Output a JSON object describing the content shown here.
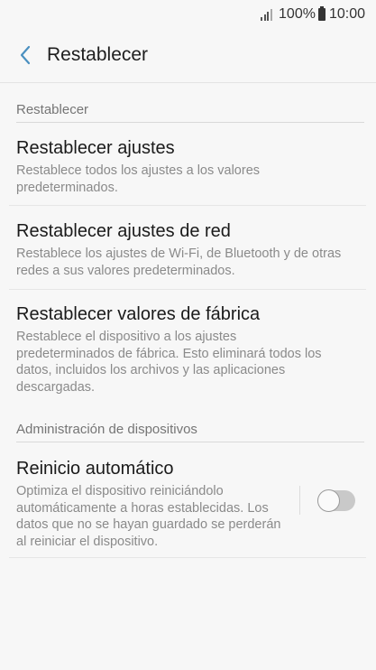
{
  "status_bar": {
    "battery": "100%",
    "time": "10:00"
  },
  "app_bar": {
    "title": "Restablecer"
  },
  "sections": [
    {
      "header": "Restablecer"
    },
    {
      "header": "Administración de dispositivos"
    }
  ],
  "items": [
    {
      "title": "Restablecer ajustes",
      "desc": "Restablece todos los ajustes a los valores predeterminados."
    },
    {
      "title": "Restablecer ajustes de red",
      "desc": "Restablece los ajustes de Wi-Fi, de Bluetooth y de otras redes a sus valores predeterminados."
    },
    {
      "title": "Restablecer valores de fábrica",
      "desc": "Restablece el dispositivo a los ajustes predeterminados de fábrica. Esto eliminará todos los datos, incluidos los archivos y las aplicaciones descargadas."
    },
    {
      "title": "Reinicio automático",
      "desc": "Optimiza el dispositivo reiniciándolo automáticamente a horas establecidas. Los datos que no se hayan guardado se perderán al reiniciar el dispositivo.",
      "toggle_on": false
    }
  ],
  "colors": {
    "accent": "#4a90c0",
    "toggle_off": "#c9c9c9"
  },
  "icons": {
    "back": "chevron-left-icon",
    "signal": "signal-icon",
    "battery": "battery-icon"
  }
}
